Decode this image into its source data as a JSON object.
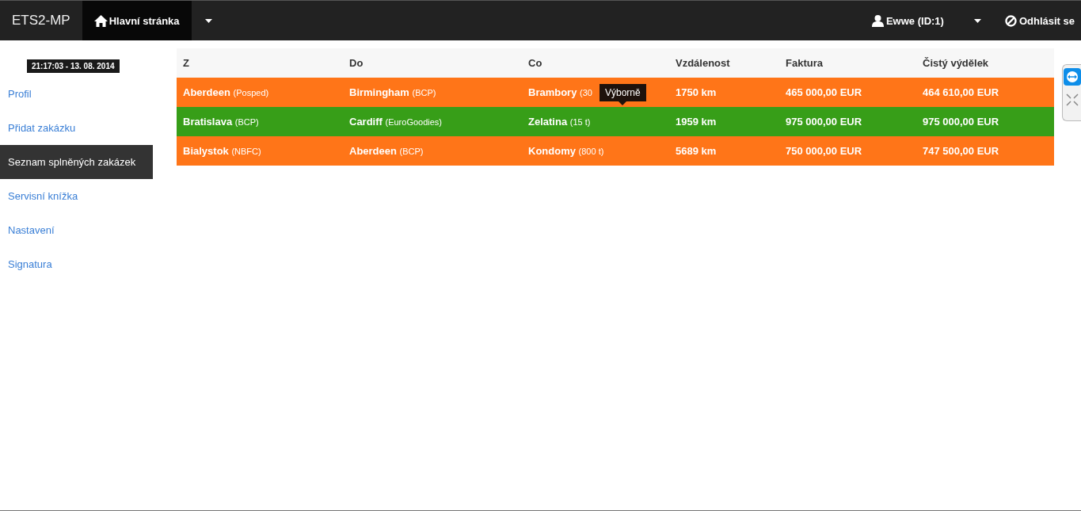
{
  "navbar": {
    "brand": "ETS2-MP",
    "home_tab": {
      "label": "Hlavní stránka",
      "selected": true
    },
    "user": "Ewwe (ID:1)",
    "logout": "Odhlásit se"
  },
  "clock": "21:17:03 - 13. 08. 2014",
  "sidebar": {
    "items": [
      {
        "label": "Profil",
        "selected": false
      },
      {
        "label": "Přidat zakázku",
        "selected": false
      },
      {
        "label": "Seznam splněných zakázek",
        "selected": true
      },
      {
        "label": "Servisní knížka",
        "selected": false
      },
      {
        "label": "Nastavení",
        "selected": false
      },
      {
        "label": "Signatura",
        "selected": false
      }
    ]
  },
  "table": {
    "columns": [
      "Z",
      "Do",
      "Co",
      "Vzdálenost",
      "Faktura",
      "Čistý výdělek"
    ],
    "rows": [
      {
        "color": "#ff7518",
        "from": "Aberdeen",
        "from_company": "(Posped)",
        "to": "Birmingham",
        "to_company": "(BCP)",
        "cargo": "Brambory",
        "cargo_amount": "(30",
        "distance": "1750 km",
        "invoice": "465 000,00 EUR",
        "profit": "464 610,00 EUR",
        "tooltip": "Výborně"
      },
      {
        "color": "#379e18",
        "from": "Bratislava",
        "from_company": "(BCP)",
        "to": "Cardiff",
        "to_company": "(EuroGoodies)",
        "cargo": "Zelatina",
        "cargo_amount": "(15 t)",
        "distance": "1959 km",
        "invoice": "975 000,00 EUR",
        "profit": "975 000,00 EUR"
      },
      {
        "color": "#ff7518",
        "from": "Bialystok",
        "from_company": "(NBFC)",
        "to": "Aberdeen",
        "to_company": "(BCP)",
        "cargo": "Kondomy",
        "cargo_amount": "(800 t)",
        "distance": "5689 km",
        "invoice": "750 000,00 EUR",
        "profit": "747 500,00 EUR"
      }
    ]
  }
}
